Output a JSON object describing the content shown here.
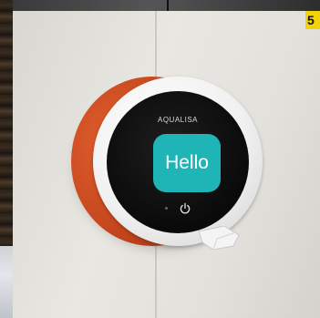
{
  "badge": {
    "number": "5"
  },
  "device": {
    "brand": "AQUALISA",
    "display_text": "Hello",
    "power_icon": "power-icon",
    "colors": {
      "accent_orange": "#c7471f",
      "screen_teal": "#1fb4b6",
      "bezel_white": "#f1f1f1",
      "screen_black": "#0a0a0a"
    }
  }
}
